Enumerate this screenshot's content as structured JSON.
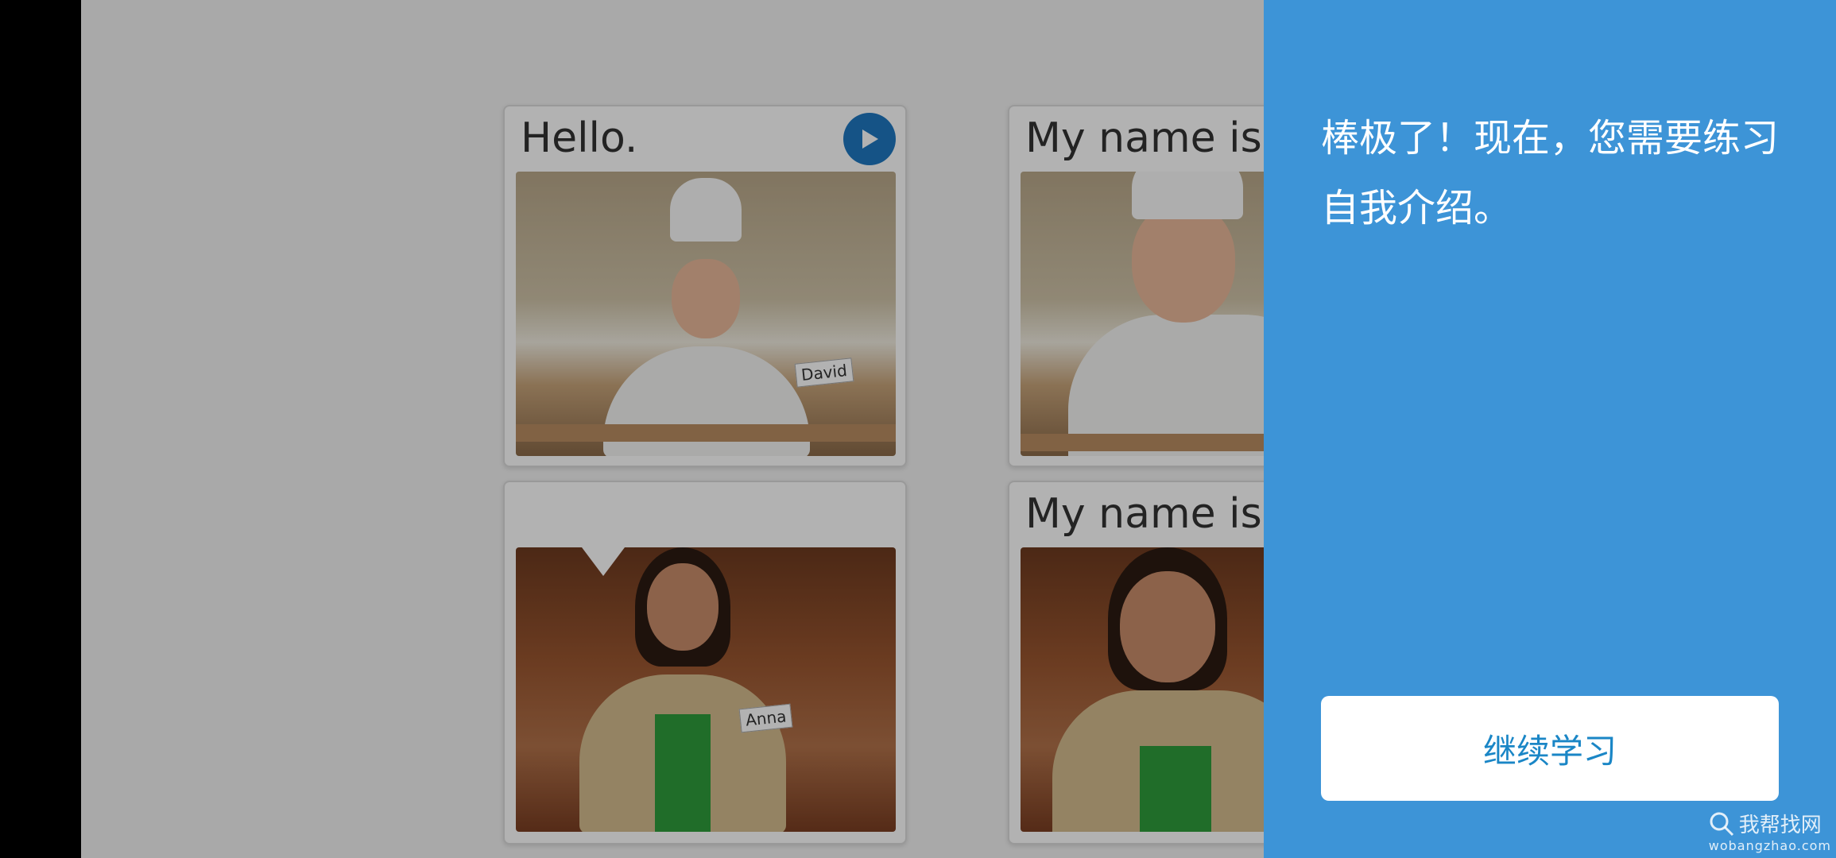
{
  "cards": [
    {
      "title": "Hello.",
      "name_tag": "David"
    },
    {
      "title": "My name is Da"
    },
    {
      "title": ""
    },
    {
      "title": "My name is An",
      "name_tag": "Anna"
    }
  ],
  "side_panel": {
    "message": "棒极了！现在，您需要练习自我介绍。",
    "button_label": "继续学习",
    "background_color": "#3d94d7",
    "button_text_color": "#1a86c6"
  },
  "watermark": {
    "text": "我帮找网",
    "url": "wobangzhao.com"
  }
}
